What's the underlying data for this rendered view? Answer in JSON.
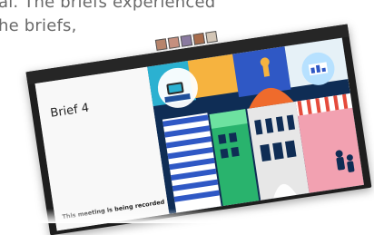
{
  "document": {
    "lines": [
      "al. The briefs experienced",
      "he briefs,",
      ""
    ]
  },
  "screenshot": {
    "slide": {
      "title": "Brief 4",
      "recording_notice": "This meeting is being recorded"
    },
    "participants": [
      "participant-1",
      "participant-2",
      "participant-3",
      "participant-4",
      "participant-5"
    ]
  }
}
